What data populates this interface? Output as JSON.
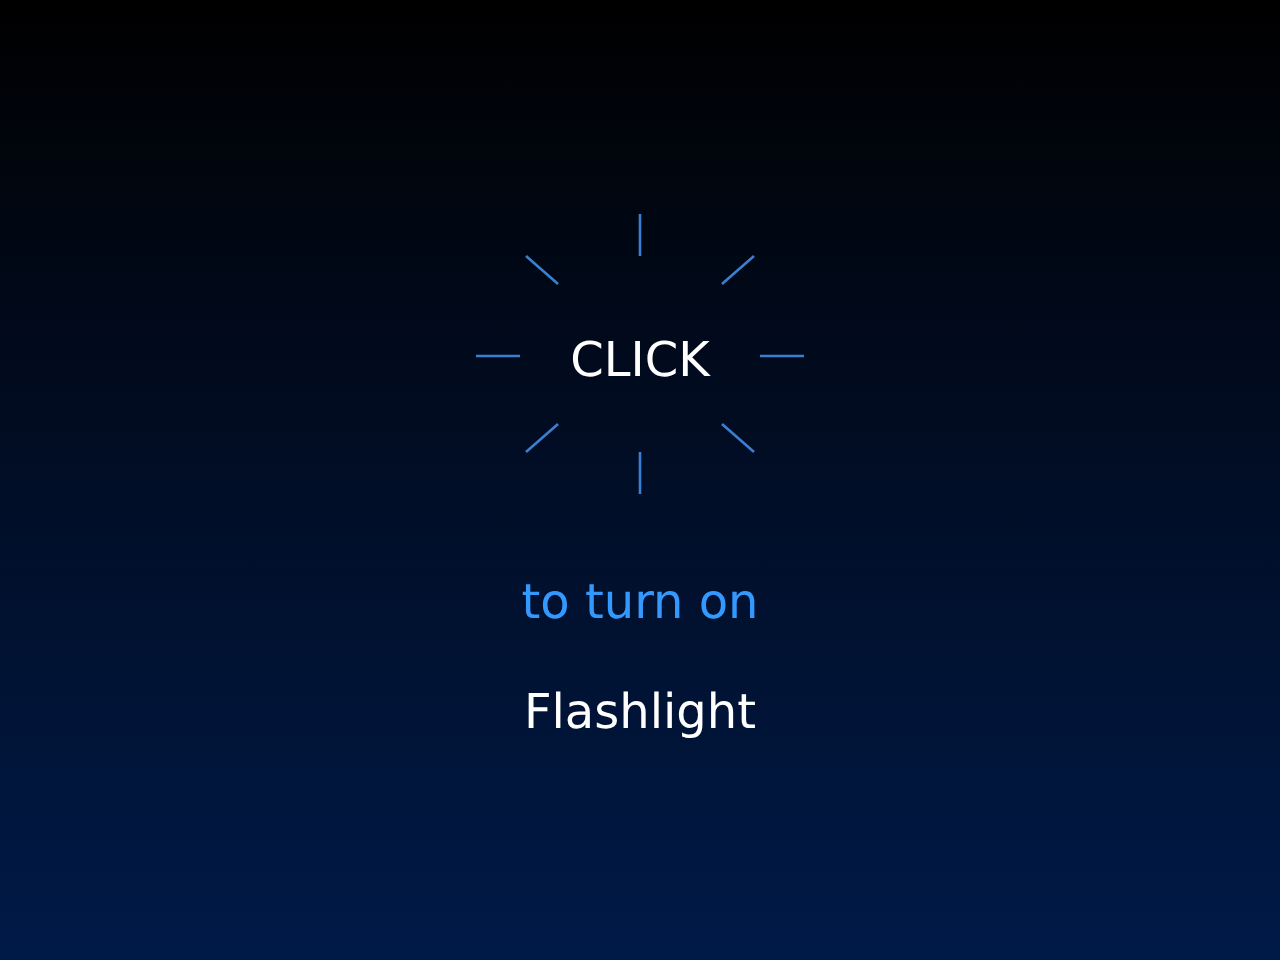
{
  "button": {
    "label": "CLICK"
  },
  "subtitle": "to turn on",
  "title": "Flashlight"
}
